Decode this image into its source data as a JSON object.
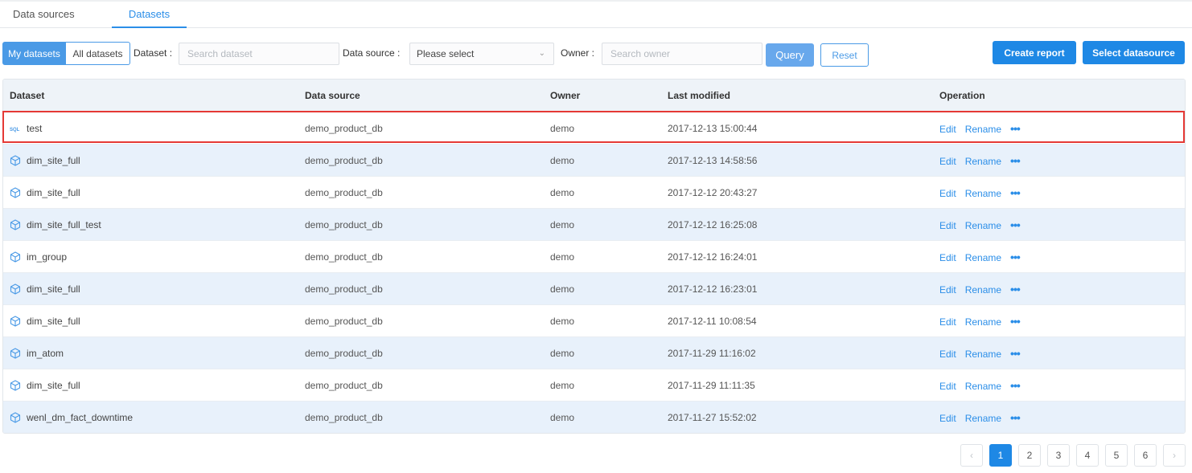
{
  "tabs": [
    "Data sources",
    "Datasets"
  ],
  "filters": {
    "my_datasets": "My datasets",
    "all_datasets": "All datasets",
    "dataset_label": "Dataset :",
    "dataset_placeholder": "Search dataset",
    "datasource_label": "Data source :",
    "datasource_select": "Please select",
    "owner_label": "Owner :",
    "owner_placeholder": "Search owner",
    "query": "Query",
    "reset": "Reset"
  },
  "actions": {
    "create_report": "Create report",
    "select_datasource": "Select datasource"
  },
  "table": {
    "columns": [
      "Dataset",
      "Data source",
      "Owner",
      "Last modified",
      "Operation"
    ],
    "op_edit": "Edit",
    "op_rename": "Rename",
    "op_more": "•••",
    "rows": [
      {
        "type": "SQL",
        "name": "test",
        "source": "demo_product_db",
        "owner": "demo",
        "modified": "2017-12-13 15:00:44"
      },
      {
        "type": "cube",
        "name": "dim_site_full",
        "source": "demo_product_db",
        "owner": "demo",
        "modified": "2017-12-13 14:58:56"
      },
      {
        "type": "cube",
        "name": "dim_site_full",
        "source": "demo_product_db",
        "owner": "demo",
        "modified": "2017-12-12 20:43:27"
      },
      {
        "type": "cube",
        "name": "dim_site_full_test",
        "source": "demo_product_db",
        "owner": "demo",
        "modified": "2017-12-12 16:25:08"
      },
      {
        "type": "cube",
        "name": "im_group",
        "source": "demo_product_db",
        "owner": "demo",
        "modified": "2017-12-12 16:24:01"
      },
      {
        "type": "cube",
        "name": "dim_site_full",
        "source": "demo_product_db",
        "owner": "demo",
        "modified": "2017-12-12 16:23:01"
      },
      {
        "type": "cube",
        "name": "dim_site_full",
        "source": "demo_product_db",
        "owner": "demo",
        "modified": "2017-12-11 10:08:54"
      },
      {
        "type": "cube",
        "name": "im_atom",
        "source": "demo_product_db",
        "owner": "demo",
        "modified": "2017-11-29 11:16:02"
      },
      {
        "type": "cube",
        "name": "dim_site_full",
        "source": "demo_product_db",
        "owner": "demo",
        "modified": "2017-11-29 11:11:35"
      },
      {
        "type": "cube",
        "name": "wenl_dm_fact_downtime",
        "source": "demo_product_db",
        "owner": "demo",
        "modified": "2017-11-27 15:52:02"
      }
    ]
  },
  "pagination": {
    "prev": "‹",
    "next": "›",
    "pages": [
      "1",
      "2",
      "3",
      "4",
      "5",
      "6"
    ],
    "current": "1"
  },
  "colors": {
    "accent": "#1e88e5",
    "row_alt": "#e8f1fb",
    "highlight": "#e53935"
  }
}
